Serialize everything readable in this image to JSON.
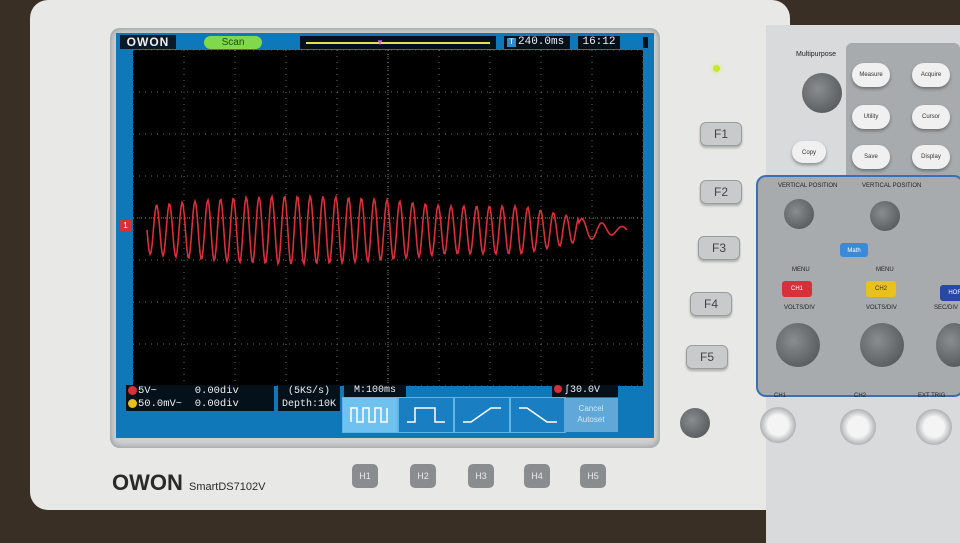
{
  "screen": {
    "brand": "OWON",
    "mode": "Scan",
    "trigger_delay": "240.0ms",
    "clock": "16:12",
    "ch1_marker": "1",
    "t_marker": "T"
  },
  "channels": {
    "ch1_scale": "5V~",
    "ch1_offset": "0.00div",
    "ch2_scale": "50.0mV~",
    "ch2_offset": "0.00div"
  },
  "acquisition": {
    "sample_rate": "(5KS/s)",
    "depth": "Depth:10K",
    "timebase": "M:100ms",
    "trigger_level": "30.0V"
  },
  "menu": {
    "cancel_label": "Cancel",
    "autoset_label": "Autoset"
  },
  "fkeys": [
    "F1",
    "F2",
    "F3",
    "F4",
    "F5"
  ],
  "hkeys": [
    "H1",
    "H2",
    "H3",
    "H4",
    "H5"
  ],
  "front_panel": {
    "logo": "OWON",
    "model": "SmartDS7102V",
    "multipurpose": "Multipurpose",
    "buttons": [
      "Measure",
      "Acquire",
      "Utility",
      "Cursor",
      "Save",
      "Display"
    ],
    "copy": "Copy",
    "vertical_position": "VERTICAL POSITION",
    "math": "Math",
    "menu": "MENU",
    "ch1": "CH1",
    "ch2": "CH2",
    "hor": "HOR",
    "volts_div": "VOLTS/DIV",
    "sec_div": "SEC/DIV",
    "ext_trig": "EXT TRIG",
    "input_ch1": "CH1",
    "input_ch2": "CH2"
  },
  "colors": {
    "trace": "#d8303a",
    "ch1": "#d8303a",
    "ch2": "#e8c020",
    "screen_blue": "#0e78b8"
  }
}
